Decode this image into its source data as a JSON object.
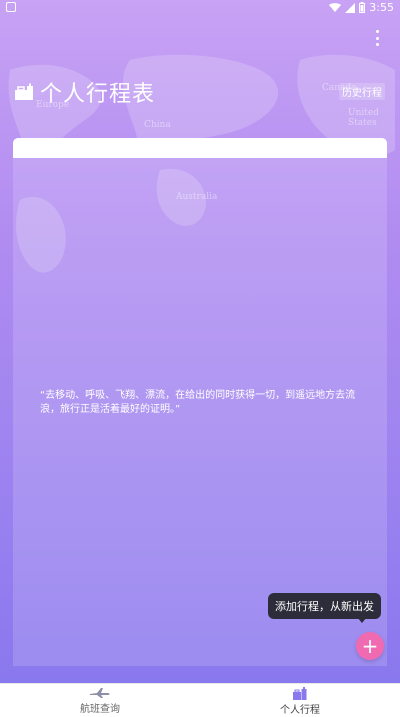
{
  "status_bar": {
    "time": "3:55"
  },
  "map_labels": {
    "europe": "Europe",
    "china": "China",
    "australia": "Australia",
    "canada": "Canada",
    "united_states": "United States"
  },
  "header": {
    "title": "个人行程表",
    "history_label": "历史行程"
  },
  "quote": "“去移动、呼吸、飞翔、漂流，在给出的同时获得一切，到遥远地方去流浪，旅行正是活着最好的证明。”",
  "tooltip": "添加行程，从新出发",
  "fab_symbol": "+",
  "bottom_nav": {
    "items": [
      {
        "label": "航班查询",
        "icon": "airplane-icon",
        "active": false
      },
      {
        "label": "个人行程",
        "icon": "luggage-icon",
        "active": true
      }
    ]
  },
  "colors": {
    "fab": "#f06ab1",
    "gradient_top": "#c8a2f4",
    "gradient_bottom": "#8a78ee",
    "nav_active_icon": "#8a78ee"
  }
}
